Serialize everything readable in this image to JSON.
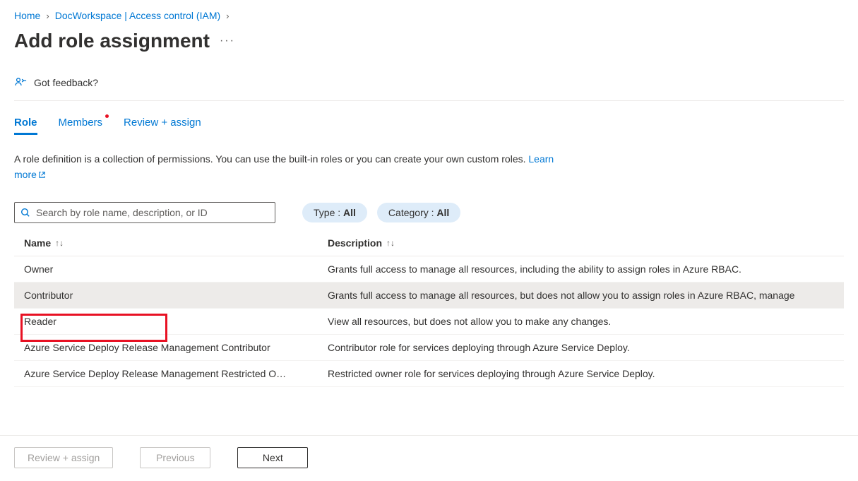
{
  "breadcrumb": {
    "home": "Home",
    "workspace": "DocWorkspace | Access control (IAM)"
  },
  "page_title": "Add role assignment",
  "feedback": {
    "label": "Got feedback?"
  },
  "tabs": {
    "role": "Role",
    "members": "Members",
    "review": "Review + assign"
  },
  "description": {
    "text": "A role definition is a collection of permissions. You can use the built-in roles or you can create your own custom roles. ",
    "learn_more": "Learn more"
  },
  "search": {
    "placeholder": "Search by role name, description, or ID"
  },
  "filters": {
    "type_label": "Type : ",
    "type_value": "All",
    "category_label": "Category : ",
    "category_value": "All"
  },
  "table": {
    "headers": {
      "name": "Name",
      "description": "Description"
    },
    "rows": [
      {
        "name": "Owner",
        "description": "Grants full access to manage all resources, including the ability to assign roles in Azure RBAC."
      },
      {
        "name": "Contributor",
        "description": "Grants full access to manage all resources, but does not allow you to assign roles in Azure RBAC, manage"
      },
      {
        "name": "Reader",
        "description": "View all resources, but does not allow you to make any changes."
      },
      {
        "name": "Azure Service Deploy Release Management Contributor",
        "description": "Contributor role for services deploying through Azure Service Deploy."
      },
      {
        "name": "Azure Service Deploy Release Management Restricted O…",
        "description": "Restricted owner role for services deploying through Azure Service Deploy."
      }
    ]
  },
  "footer": {
    "review": "Review + assign",
    "previous": "Previous",
    "next": "Next"
  }
}
